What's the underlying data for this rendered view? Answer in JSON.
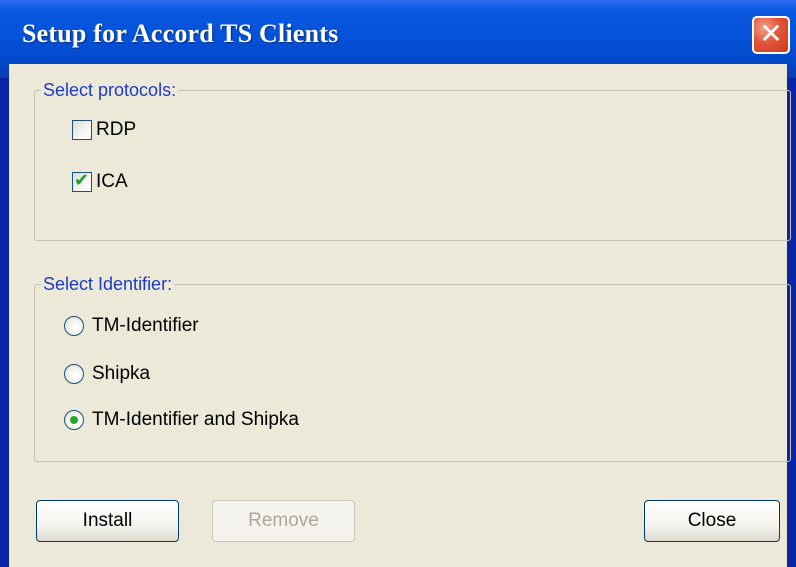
{
  "window": {
    "title": "Setup for Accord TS Clients",
    "close_glyph": "✕"
  },
  "protocols": {
    "label": "Select protocols:",
    "items": [
      {
        "label": "RDP",
        "checked": false
      },
      {
        "label": "ICA",
        "checked": true,
        "check_glyph": "✔"
      }
    ]
  },
  "identifier": {
    "label": "Select Identifier:",
    "options": [
      {
        "label": "TM-Identifier",
        "selected": false
      },
      {
        "label": "Shipka",
        "selected": false
      },
      {
        "label": "TM-Identifier and Shipka",
        "selected": true
      }
    ]
  },
  "buttons": {
    "install": {
      "label": "Install",
      "enabled": true
    },
    "remove": {
      "label": "Remove",
      "enabled": false
    },
    "close": {
      "label": "Close",
      "enabled": true
    }
  },
  "colors": {
    "title_bar": "#0552da",
    "dialog_face": "#ece9d8",
    "group_label": "#1e3bc4",
    "check_accent": "#21a121"
  }
}
